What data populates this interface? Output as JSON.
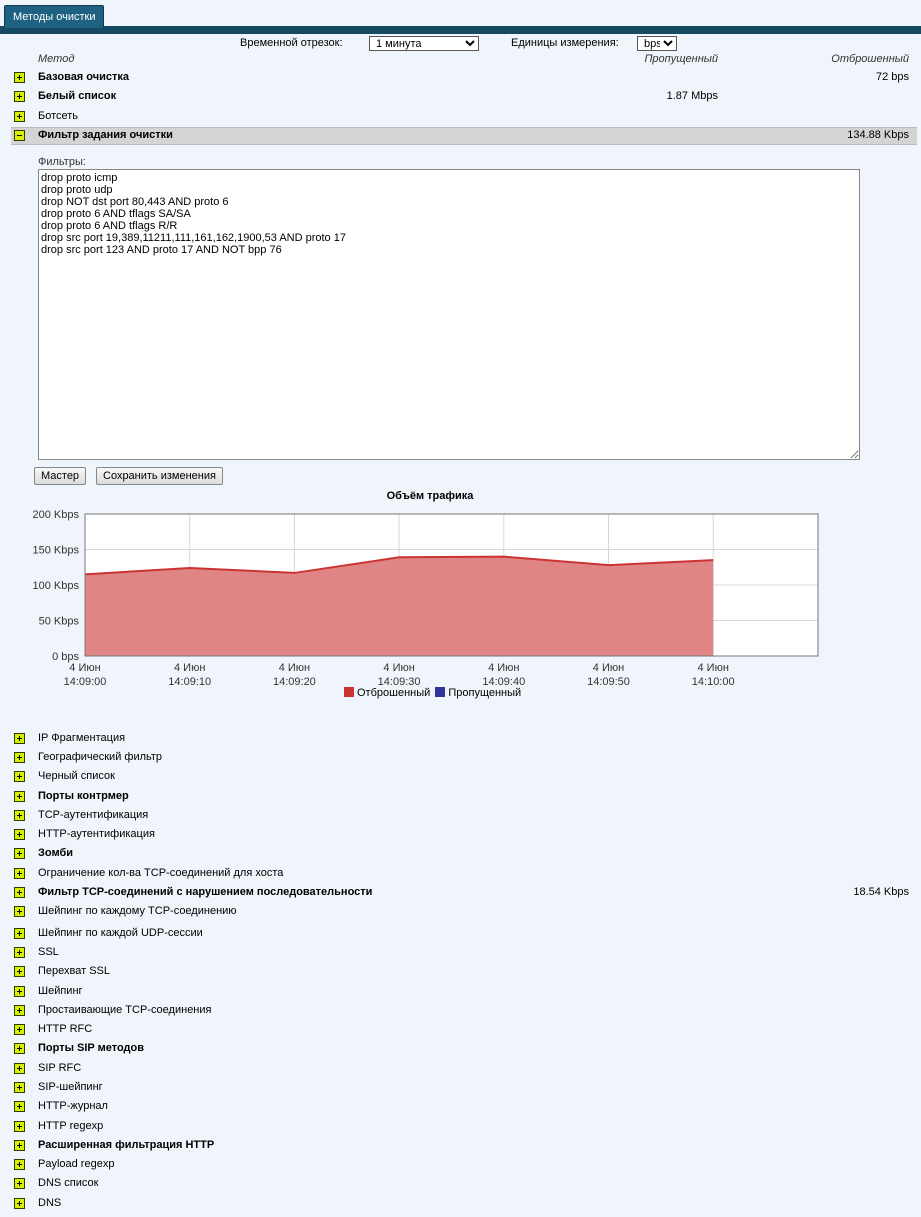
{
  "tab": {
    "label": "Методы очистки"
  },
  "controls": {
    "time_label": "Временной отрезок:",
    "time_value": "1 минута",
    "units_label": "Единицы измерения:",
    "units_value": "bps"
  },
  "columns": {
    "method": "Метод",
    "passed": "Пропущенный",
    "dropped": "Отброшенный"
  },
  "top_rows": [
    {
      "label": "Базовая очистка",
      "bold": true,
      "passed": "",
      "dropped": "72 bps"
    },
    {
      "label": "Белый список",
      "bold": true,
      "passed": "1.87 Mbps",
      "dropped": ""
    },
    {
      "label": "Ботсеть",
      "bold": false,
      "passed": "",
      "dropped": ""
    }
  ],
  "expanded": {
    "label": "Фильтр задания очистки",
    "dropped": "134.88 Kbps",
    "filters_label": "Фильтры:",
    "filters_text": "drop proto icmp\ndrop proto udp\ndrop NOT dst port 80,443 AND proto 6\ndrop proto 6 AND tflags SA/SA\ndrop proto 6 AND tflags R/R\ndrop src port 19,389,11211,111,161,162,1900,53 AND proto 17\ndrop src port 123 AND proto 17 AND NOT bpp 76",
    "wizard_button": "Мастер",
    "save_button": "Сохранить изменения"
  },
  "chart_data": {
    "type": "area",
    "title": "Объём трафика",
    "categories": [
      "4 Июн 14:09:00",
      "4 Июн 14:09:10",
      "4 Июн 14:09:20",
      "4 Июн 14:09:30",
      "4 Июн 14:09:40",
      "4 Июн 14:09:50",
      "4 Июн 14:10:00"
    ],
    "x_date_line": "4 Июн",
    "x_time_labels": [
      "14:09:00",
      "14:09:10",
      "14:09:20",
      "14:09:30",
      "14:09:40",
      "14:09:50",
      "14:10:00"
    ],
    "y_ticks": [
      "0 bps",
      "50 Kbps",
      "100 Kbps",
      "150 Kbps",
      "200 Kbps"
    ],
    "ylim": [
      0,
      200
    ],
    "y_unit": "Kbps",
    "series": [
      {
        "name": "Отброшенный",
        "color": "#cc3333",
        "values": [
          115,
          124,
          117,
          139,
          140,
          128,
          135
        ]
      },
      {
        "name": "Пропущенный",
        "color": "#333399",
        "values": [
          0,
          0,
          0,
          0,
          0,
          0,
          0
        ]
      }
    ],
    "grid": true,
    "legend": "bottom"
  },
  "bottom_rows": [
    {
      "label": "IP Фрагментация",
      "bold": false,
      "dropped": ""
    },
    {
      "label": "Географический фильтр",
      "bold": false,
      "dropped": ""
    },
    {
      "label": "Черный список",
      "bold": false,
      "dropped": ""
    },
    {
      "label": "Порты контрмер",
      "bold": true,
      "dropped": ""
    },
    {
      "label": "TCP-аутентификация",
      "bold": false,
      "dropped": ""
    },
    {
      "label": "HTTP-аутентификация",
      "bold": false,
      "dropped": ""
    },
    {
      "label": "Зомби",
      "bold": true,
      "dropped": ""
    },
    {
      "label": "Ограничение кол-ва TCP-соединений для хоста",
      "bold": false,
      "dropped": ""
    },
    {
      "label": "Фильтр TCP-соединений с нарушением последовательности",
      "bold": true,
      "dropped": "18.54 Kbps"
    },
    {
      "label": "Шейпинг по каждому TCP-соединению",
      "bold": false,
      "dropped": ""
    },
    {
      "label": "Шейпинг по каждой UDP-сессии",
      "bold": false,
      "dropped": ""
    },
    {
      "label": "SSL",
      "bold": false,
      "dropped": ""
    },
    {
      "label": "Перехват SSL",
      "bold": false,
      "dropped": ""
    },
    {
      "label": "Шейпинг",
      "bold": false,
      "dropped": ""
    },
    {
      "label": "Простаивающие TCP-соединения",
      "bold": false,
      "dropped": ""
    },
    {
      "label": "HTTP RFC",
      "bold": false,
      "dropped": ""
    },
    {
      "label": "Порты SIP методов",
      "bold": true,
      "dropped": ""
    },
    {
      "label": "SIP RFC",
      "bold": false,
      "dropped": ""
    },
    {
      "label": "SIP-шейпинг",
      "bold": false,
      "dropped": ""
    },
    {
      "label": "HTTP-журнал",
      "bold": false,
      "dropped": ""
    },
    {
      "label": "HTTP regexp",
      "bold": false,
      "dropped": ""
    },
    {
      "label": "Расширенная фильтрация HTTP",
      "bold": true,
      "dropped": ""
    },
    {
      "label": "Payload regexp",
      "bold": false,
      "dropped": ""
    },
    {
      "label": "DNS список",
      "bold": false,
      "dropped": ""
    },
    {
      "label": "DNS",
      "bold": false,
      "dropped": ""
    }
  ]
}
